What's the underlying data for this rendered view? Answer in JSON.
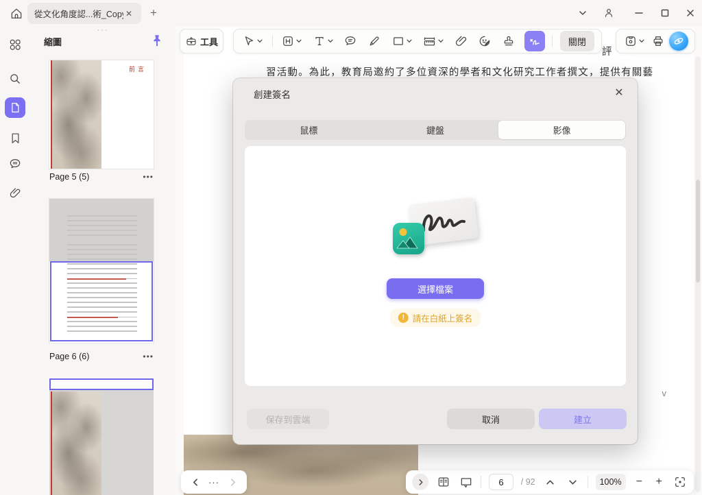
{
  "titlebar": {
    "tab_title": "從文化角度認...術_Copy",
    "new_tab_label": "+"
  },
  "sidebar": {
    "title": "縮圖",
    "handle_dots": "···",
    "thumbnails": [
      {
        "label": "Page 5 (5)",
        "overlay_text": "前言",
        "menu_dots": "•••"
      },
      {
        "label": "Page 6 (6)",
        "menu_dots": "•••"
      },
      {
        "label": ""
      }
    ]
  },
  "toolbar": {
    "tools_label": "工具",
    "close_label": "關閉"
  },
  "document": {
    "visible_line": "習活動。為此，教育局邀約了多位資深的學者和文化研究工作者撰文，提供有關藝",
    "partial_char": "評",
    "scroll_chevron": "v"
  },
  "dialog": {
    "title": "創建簽名",
    "close_icon": "✕",
    "tabs": [
      {
        "label": "鼠標"
      },
      {
        "label": "鍵盤"
      },
      {
        "label": "影像"
      }
    ],
    "choose_file_button": "選擇檔案",
    "hint_icon": "!",
    "hint_text": "請在白紙上簽名",
    "save_cloud_button": "保存到雲端",
    "cancel_button": "取消",
    "create_button": "建立"
  },
  "statusbar": {
    "back_more_dots": "···",
    "page_input": "6",
    "page_total": "/ 92",
    "zoom_value": "100%",
    "minus": "−",
    "plus": "+"
  },
  "colors": {
    "accent_purple": "#7B70F2",
    "create_button_bg": "#CCC8F4",
    "warning_amber": "#DAA32A",
    "ai_blue": "#38A6F8",
    "thumb_red_accent": "#C0392B",
    "view_rect_purple": "#6F66EA"
  }
}
